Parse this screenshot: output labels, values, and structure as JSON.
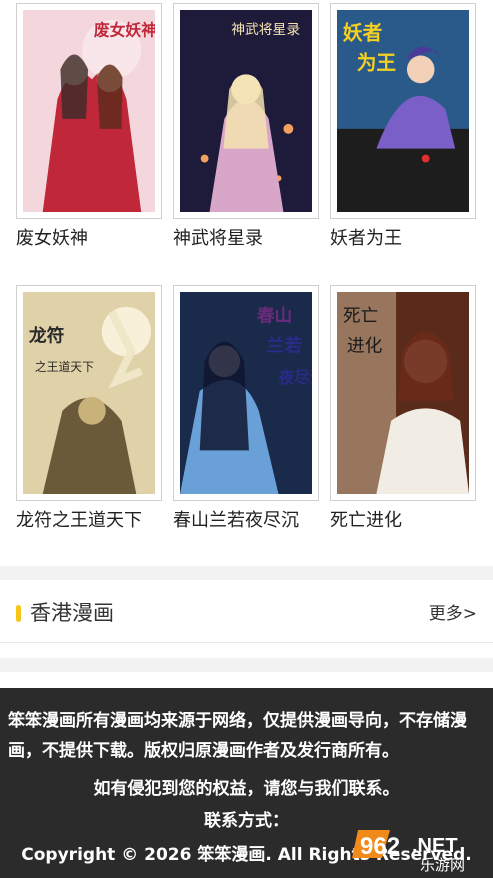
{
  "comics": [
    {
      "title": "废女妖神",
      "cover_icon": "comic-cover",
      "colors": [
        "#f3d7dc",
        "#c0283a",
        "#3a2a2a"
      ]
    },
    {
      "title": "神武将星录",
      "cover_icon": "comic-cover",
      "colors": [
        "#1e1a3a",
        "#d8a6c8",
        "#f3e3b0"
      ]
    },
    {
      "title": "妖者为王",
      "cover_icon": "comic-cover",
      "colors": [
        "#2a5a8a",
        "#7a5fc8",
        "#1d1d1d"
      ]
    },
    {
      "title": "龙符之王道天下",
      "cover_icon": "comic-cover",
      "colors": [
        "#c9b27a",
        "#6b5a3a",
        "#e0d2a8"
      ]
    },
    {
      "title": "春山兰若夜尽沉",
      "cover_icon": "comic-cover",
      "colors": [
        "#1a2a4a",
        "#6aa0d8",
        "#e8eef8"
      ]
    },
    {
      "title": "死亡进化",
      "cover_icon": "comic-cover",
      "colors": [
        "#c2a88a",
        "#5a2a1a",
        "#f1ece4"
      ]
    }
  ],
  "section": {
    "title": "香港漫画",
    "more": "更多>",
    "accent_color": "#f5c518"
  },
  "footer": {
    "line1": "笨笨漫画所有漫画均来源于网络，仅提供漫画导向，不存储漫画，不提供下载。版权归原漫画作者及发行商所有。",
    "line2": "如有侵犯到您的权益，请您与我们联系。",
    "line3": "联系方式：",
    "line4": "Copyright © 2026 笨笨漫画. All Rights Reserved."
  },
  "watermark": {
    "brand": "962",
    "suffix": ".NET",
    "sub": "乐游网"
  }
}
